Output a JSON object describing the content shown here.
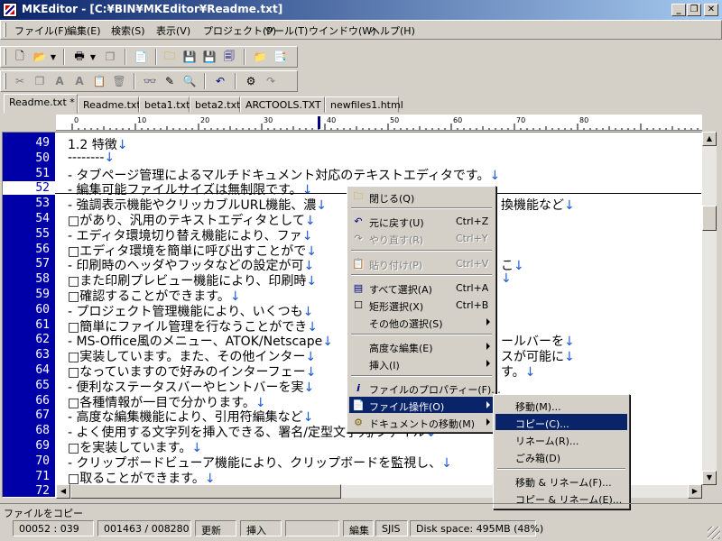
{
  "window": {
    "title": "MKEditor - [C:¥BIN¥MKEditor¥Readme.txt]",
    "controls": {
      "minimize": "_",
      "restore": "❐",
      "close": "✕"
    }
  },
  "menubar": [
    {
      "label": "ファイル(F)"
    },
    {
      "label": "編集(E)"
    },
    {
      "label": "検索(S)"
    },
    {
      "label": "表示(V)"
    },
    {
      "label": "プロジェクト(P)"
    },
    {
      "label": "ツール(T)"
    },
    {
      "label": "ウインドウ(W)"
    },
    {
      "label": "ヘルプ(H)"
    }
  ],
  "tabs": [
    {
      "label": "Readme.txt *"
    },
    {
      "label": "Readme.txt"
    },
    {
      "label": "beta1.txt"
    },
    {
      "label": "beta2.txt"
    },
    {
      "label": "ARCTOOLS.TXT"
    },
    {
      "label": "newfiles1.html"
    }
  ],
  "ruler": {
    "marks": [
      "0",
      "10",
      "20",
      "30",
      "40",
      "50",
      "60",
      "70",
      "80"
    ]
  },
  "editor": {
    "return_mark": "↓",
    "lines": [
      {
        "num": "49",
        "text": "1.2 特徴"
      },
      {
        "num": "50",
        "text": "--------"
      },
      {
        "num": "51",
        "text": "- タブページ管理によるマルチドキュメント対応のテキストエディタです。"
      },
      {
        "num": "52",
        "text": "- 編集可能ファイルサイズは無制限です。"
      },
      {
        "num": "53",
        "text": "- 強調表示機能やクリッカブルURL機能、濃"
      },
      {
        "num": "54",
        "text": "□があり、汎用のテキストエディタとして"
      },
      {
        "num": "55",
        "text": "- エディタ環境切り替え機能により、ファ"
      },
      {
        "num": "56",
        "text": "□エディタ環境を簡単に呼び出すことがで"
      },
      {
        "num": "57",
        "text": "- 印刷時のヘッダやフッタなどの設定が可"
      },
      {
        "num": "58",
        "text": "□また印刷プレビュー機能により、印刷時"
      },
      {
        "num": "59",
        "text": "□確認することができます。"
      },
      {
        "num": "60",
        "text": "- プロジェクト管理機能により、いくつも"
      },
      {
        "num": "61",
        "text": "□簡単にファイル管理を行なうことができ"
      },
      {
        "num": "62",
        "text": "- MS-Office風のメニュー、ATOK/Netscape"
      },
      {
        "num": "63",
        "text": "□実装しています。また、その他インター"
      },
      {
        "num": "64",
        "text": "□なっていますので好みのインターフェー"
      },
      {
        "num": "65",
        "text": "- 便利なステータスバーやヒントバーを実"
      },
      {
        "num": "66",
        "text": "□各種情報が一目で分かります。"
      },
      {
        "num": "67",
        "text": "- 高度な編集機能により、引用符編集など"
      },
      {
        "num": "68",
        "text": "- よく使用する文字列を挿入できる、署名/定型文字列/ファイル"
      },
      {
        "num": "69",
        "text": "□を実装しています。"
      },
      {
        "num": "70",
        "text": "- クリップボードビューア機能により、クリップボードを監視し、"
      },
      {
        "num": "71",
        "text": "□取ることができます。"
      },
      {
        "num": "72",
        "text": ""
      }
    ],
    "tails": {
      "53": "換機能など",
      "57": "こ",
      "58": "",
      "62": "ールバーを",
      "63": "スが可能に",
      "64": "す。"
    }
  },
  "context_menu": {
    "items": [
      {
        "label": "閉じる(Q)",
        "icon": "folder-icon"
      },
      {
        "label": "元に戻す(U)",
        "shortcut": "Ctrl+Z",
        "icon": "undo-icon"
      },
      {
        "label": "やり直す(R)",
        "shortcut": "Ctrl+Y",
        "icon": "redo-icon",
        "disabled": true
      },
      {
        "label": "貼り付け(P)",
        "shortcut": "Ctrl+V",
        "icon": "paste-icon",
        "disabled": true
      },
      {
        "label": "すべて選択(A)",
        "shortcut": "Ctrl+A",
        "icon": "select-all-icon"
      },
      {
        "label": "矩形選択(X)",
        "shortcut": "Ctrl+B",
        "icon": "rect-select-icon"
      },
      {
        "label": "その他の選択(S)",
        "submenu": true
      },
      {
        "label": "高度な編集(E)",
        "submenu": true
      },
      {
        "label": "挿入(I)",
        "submenu": true
      },
      {
        "label": "ファイルのプロパティー(F)...",
        "icon": "info-icon"
      },
      {
        "label": "ファイル操作(O)",
        "submenu": true,
        "highlighted": true,
        "icon": "file-ops-icon"
      },
      {
        "label": "ドキュメントの移動(M)",
        "submenu": true,
        "icon": "doc-move-icon"
      }
    ]
  },
  "submenu": {
    "items": [
      {
        "label": "移動(M)..."
      },
      {
        "label": "コピー(C)...",
        "highlighted": true
      },
      {
        "label": "リネーム(R)..."
      },
      {
        "label": "ごみ箱(D)"
      },
      {
        "label": "移動 & リネーム(F)..."
      },
      {
        "label": "コピー & リネーム(E)..."
      }
    ]
  },
  "status": {
    "message": "ファイルをコピー",
    "cursor": "00052 : 039",
    "position": "001463 / 008280",
    "modified": "更新",
    "insert_mode": "挿入",
    "edit_mode": "編集",
    "encoding": "SJIS",
    "disk_space": "Disk space: 495MB (48%)"
  },
  "colors": {
    "gutter": "#0000a8",
    "highlight": "#0a246a",
    "return_mark": "#1e5bd6"
  }
}
